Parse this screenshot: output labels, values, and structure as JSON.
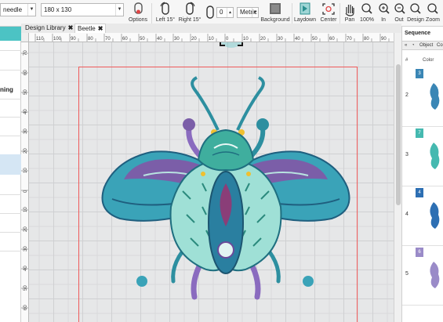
{
  "toolbar": {
    "needle_select": "needle",
    "size_select": "180 x 130",
    "options_label": "Options",
    "left15_label": "Left 15°",
    "right15_label": "Right 15°",
    "angle_value": "0",
    "units_select": "Metric",
    "background_label": "Background",
    "laydown_label": "Laydown",
    "center_label": "Center",
    "pan_label": "Pan",
    "zoom100_label": "100%",
    "zoomin_label": "In",
    "zoomout_label": "Out",
    "design_label": "Design",
    "zoom_label": "Zoom"
  },
  "left_panel": {
    "partial_text": "ning"
  },
  "tabs": [
    {
      "label": "Design Library",
      "close": "✖"
    },
    {
      "label": "Beetle",
      "close": "✖"
    }
  ],
  "h_ruler": [
    "110",
    "100",
    "90",
    "80",
    "70",
    "60",
    "50",
    "40",
    "30",
    "20",
    "10",
    "0",
    "10",
    "20",
    "30",
    "40",
    "50",
    "60",
    "70",
    "80",
    "90"
  ],
  "v_ruler": [
    "70",
    "60",
    "50",
    "40",
    "30",
    "20",
    "10",
    "0",
    "10",
    "20",
    "30",
    "40",
    "50",
    "60",
    "70"
  ],
  "sequence_panel": {
    "title": "Sequence",
    "tab_label": "Object",
    "tab_label2": "Col",
    "header_num": "#",
    "header_col": "Color",
    "rows": [
      {
        "num": "2",
        "swatch": "#3a86b5",
        "swatch_text": "3"
      },
      {
        "num": "3",
        "swatch": "#45b9b0",
        "swatch_text": "7"
      },
      {
        "num": "4",
        "swatch": "#2d6fb3",
        "swatch_text": "4"
      },
      {
        "num": "5",
        "swatch": "#9a8bc8",
        "swatch_text": "6"
      }
    ]
  },
  "colors": {
    "accent": "#4cc3c4",
    "hoop": "#ef5a5a",
    "target": "#e04545"
  }
}
